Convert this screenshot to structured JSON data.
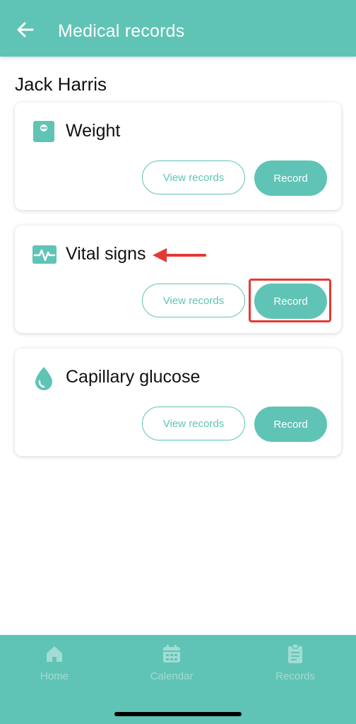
{
  "header": {
    "title": "Medical records",
    "back_icon": "arrow-left-icon"
  },
  "patient": {
    "name": "Jack Harris"
  },
  "cards": [
    {
      "title": "Weight",
      "icon": "scale-icon",
      "view_label": "View records",
      "record_label": "Record"
    },
    {
      "title": "Vital signs",
      "icon": "heartbeat-icon",
      "view_label": "View records",
      "record_label": "Record"
    },
    {
      "title": "Capillary glucose",
      "icon": "drop-icon",
      "view_label": "View records",
      "record_label": "Record"
    }
  ],
  "bottom_nav": [
    {
      "label": "Home",
      "icon": "home-icon"
    },
    {
      "label": "Calendar",
      "icon": "calendar-icon"
    },
    {
      "label": "Records",
      "icon": "clipboard-icon"
    }
  ],
  "colors": {
    "accent": "#5fc4b5",
    "annotation": "#e53935",
    "nav_inactive": "#a3dcd3"
  }
}
